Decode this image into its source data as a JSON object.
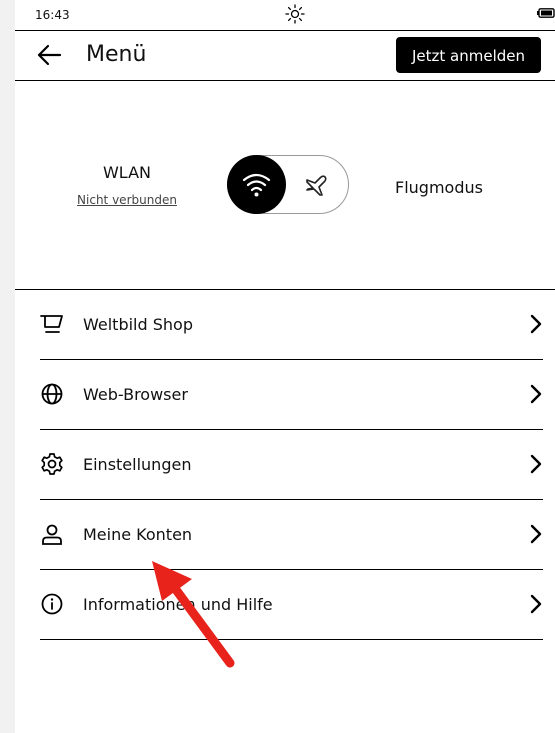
{
  "status": {
    "time": "16:43"
  },
  "header": {
    "title": "Menü",
    "login_label": "Jetzt anmelden"
  },
  "connectivity": {
    "wlan_label": "WLAN",
    "wlan_status": "Nicht verbunden",
    "flight_label": "Flugmodus"
  },
  "menu": {
    "items": [
      {
        "label": "Weltbild Shop",
        "icon": "cart-icon"
      },
      {
        "label": "Web-Browser",
        "icon": "globe-icon"
      },
      {
        "label": "Einstellungen",
        "icon": "gear-icon"
      },
      {
        "label": "Meine Konten",
        "icon": "user-icon"
      },
      {
        "label": "Informationen und Hilfe",
        "icon": "info-icon"
      }
    ]
  },
  "colors": {
    "accent": "#000000",
    "annotation": "#e8231c"
  }
}
